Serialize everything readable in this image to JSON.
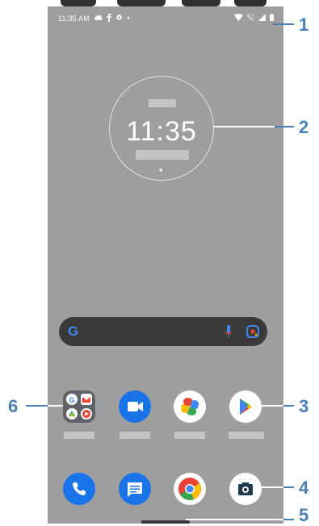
{
  "status_bar": {
    "time": "11:35 AM",
    "notifications": [
      "cloud-icon",
      "facebook-icon",
      "settings-icon",
      "dot-icon"
    ],
    "system": [
      "wifi-icon",
      "signal-icon",
      "battery-icon"
    ]
  },
  "clock": {
    "time": "11:35"
  },
  "search": {
    "logo": "G",
    "mic_icon": "mic-icon",
    "lens_icon": "lens-icon"
  },
  "apps_row1": [
    {
      "name": "google-folder",
      "icon": "folder-icon"
    },
    {
      "name": "duo",
      "icon": "video-icon",
      "color": "#1a73e8"
    },
    {
      "name": "photos",
      "icon": "photos-icon"
    },
    {
      "name": "play-store",
      "icon": "play-icon"
    }
  ],
  "dock": [
    {
      "name": "phone",
      "icon": "phone-icon",
      "color": "#1a73e8"
    },
    {
      "name": "messages",
      "icon": "messages-icon",
      "color": "#1a73e8"
    },
    {
      "name": "chrome",
      "icon": "chrome-icon"
    },
    {
      "name": "camera",
      "icon": "camera-icon"
    }
  ],
  "callouts": {
    "c1": "1",
    "c2": "2",
    "c3": "3",
    "c4": "4",
    "c5": "5",
    "c6": "6"
  },
  "colors": {
    "wallpaper": "#9e9e9e",
    "callout": "#4a7fb5",
    "search_bar": "#3a3a3a"
  }
}
